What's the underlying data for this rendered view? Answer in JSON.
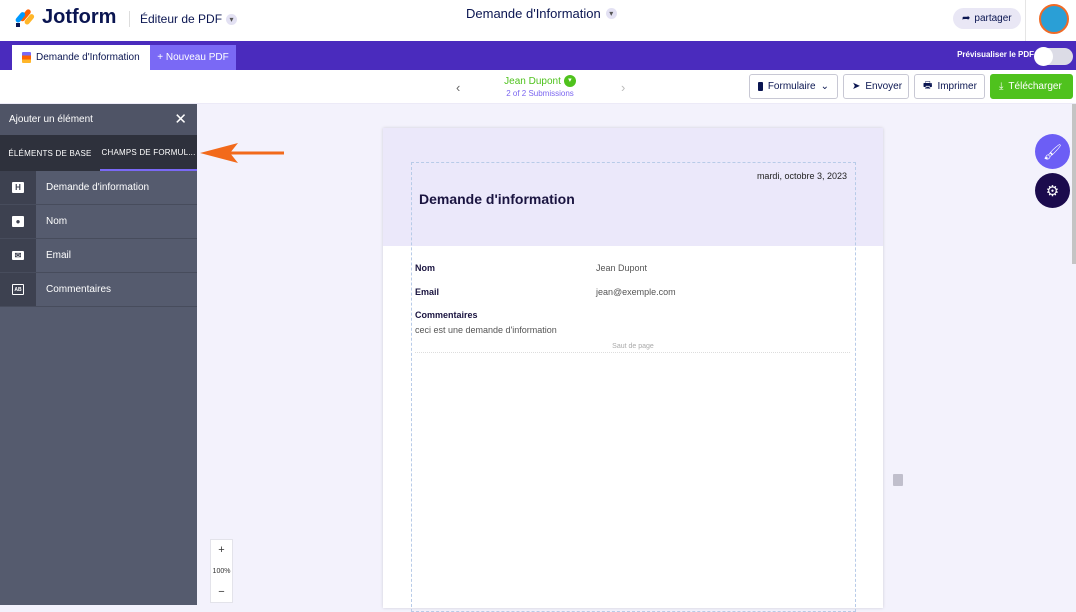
{
  "header": {
    "logo": "Jotform",
    "editor_label": "Éditeur de PDF",
    "doc_title": "Demande d'Information",
    "share_label": "partager"
  },
  "tabs": {
    "active": "Demande d'Information",
    "new": "+ Nouveau PDF",
    "preview_label": "Prévisualiser le PDF",
    "preview_on": false
  },
  "toolbar": {
    "submitter": "Jean Dupont",
    "submission_count": "2 of 2 Submissions",
    "form_label": "Formulaire",
    "send_label": "Envoyer",
    "print_label": "Imprimer",
    "download_label": "Télécharger",
    "prev": "‹",
    "next": "›"
  },
  "sidebar": {
    "title": "Ajouter un élément",
    "tabs": [
      "ÉLÉMENTS DE BASE",
      "CHAMPS DE FORMUL..."
    ],
    "items": [
      {
        "label": "Demande d'information",
        "icon": "heading-icon"
      },
      {
        "label": "Nom",
        "icon": "contact-icon"
      },
      {
        "label": "Email",
        "icon": "email-icon"
      },
      {
        "label": "Commentaires",
        "icon": "textarea-icon"
      }
    ]
  },
  "document": {
    "date": "mardi, octobre 3, 2023",
    "title": "Demande d'information",
    "fields": [
      {
        "label": "Nom",
        "value": "Jean Dupont"
      },
      {
        "label": "Email",
        "value": "jean@exemple.com"
      },
      {
        "label": "Commentaires",
        "value": "ceci est une demande d'information"
      }
    ],
    "page_break": "Saut de page"
  },
  "zoom": {
    "plus": "+",
    "level": "100%",
    "minus": "−"
  },
  "colors": {
    "brand": "#4a2bbd",
    "accent": "#7a69f5",
    "success": "#4fc21d",
    "arrow": "#f26a1b"
  }
}
